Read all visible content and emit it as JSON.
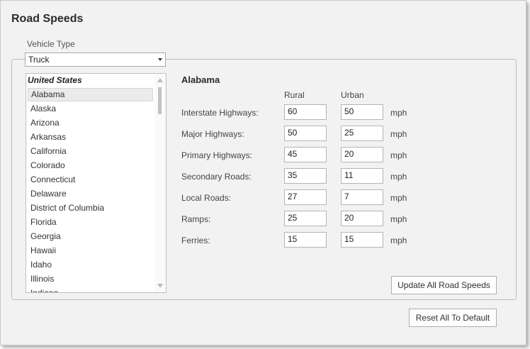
{
  "title": "Road Speeds",
  "vehicle_type": {
    "label": "Vehicle Type",
    "selected": "Truck"
  },
  "state_list": {
    "header": "United States",
    "items": [
      "Alabama",
      "Alaska",
      "Arizona",
      "Arkansas",
      "California",
      "Colorado",
      "Connecticut",
      "Delaware",
      "District of Columbia",
      "Florida",
      "Georgia",
      "Hawaii",
      "Idaho",
      "Illinois",
      "Indiana"
    ],
    "selected": "Alabama"
  },
  "detail": {
    "state": "Alabama",
    "col_rural": "Rural",
    "col_urban": "Urban",
    "unit": "mph",
    "rows": [
      {
        "label": "Interstate Highways:",
        "rural": "60",
        "urban": "50"
      },
      {
        "label": "Major Highways:",
        "rural": "50",
        "urban": "25"
      },
      {
        "label": "Primary Highways:",
        "rural": "45",
        "urban": "20"
      },
      {
        "label": "Secondary Roads:",
        "rural": "35",
        "urban": "11"
      },
      {
        "label": "Local Roads:",
        "rural": "27",
        "urban": "7"
      },
      {
        "label": "Ramps:",
        "rural": "25",
        "urban": "20"
      },
      {
        "label": "Ferries:",
        "rural": "15",
        "urban": "15"
      }
    ]
  },
  "buttons": {
    "update_all": "Update All Road Speeds",
    "reset_all": "Reset All To Default"
  },
  "icons": {
    "dropdown": "chevron-down-icon",
    "scroll_up": "scroll-up-icon",
    "scroll_down": "scroll-down-icon"
  }
}
